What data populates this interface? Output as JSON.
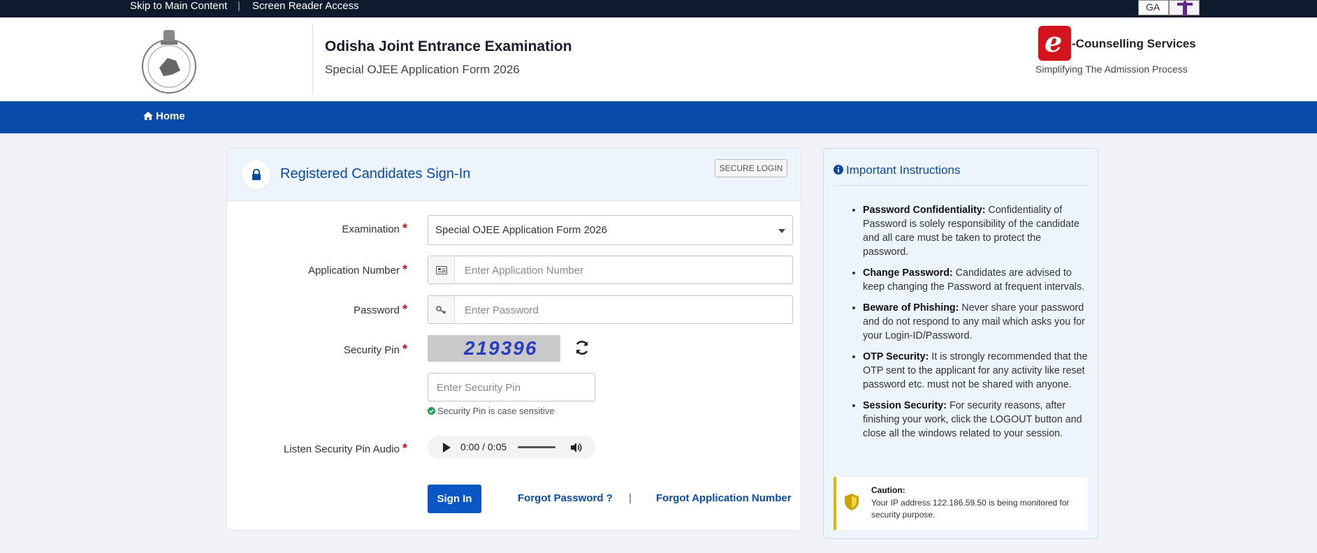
{
  "topbar": {
    "skip_link": "Skip to Main Content",
    "separator": "|",
    "screen_reader": "Screen Reader Access",
    "font_size_label": "GA",
    "accessibility_icon": "accessibility-icon"
  },
  "header": {
    "title": "Odisha Joint Entrance Examination",
    "subtitle": "Special OJEE Application Form 2026",
    "logo_letter": "e",
    "partner_name": "-Counselling Services",
    "partner_tagline": "Simplifying The Admission Process"
  },
  "nav": {
    "home": "Home"
  },
  "signin": {
    "title": "Registered Candidates Sign-In",
    "secure_badge": "SECURE LOGIN",
    "examination_label": "Examination",
    "examination_value": "Special OJEE Application Form 2026",
    "application_label": "Application Number",
    "application_placeholder": "Enter Application Number",
    "password_label": "Password",
    "password_placeholder": "Enter Password",
    "pin_label": "Security Pin",
    "captcha_text": "219396",
    "pin_placeholder": "Enter Security Pin",
    "pin_note": "Security Pin is case sensitive",
    "audio_label": "Listen Security Pin Audio",
    "audio_time": "0:00 / 0:05",
    "required_mark": "*",
    "signin_button": "Sign In",
    "forgot_password": "Forgot Password ?",
    "link_separator": "|",
    "forgot_application": "Forgot Application Number"
  },
  "instructions": {
    "title": "Important Instructions",
    "items": [
      {
        "head": "Password Confidentiality:",
        "text": " Confidentiality of Password is solely responsibility of the candidate and all care must be taken to protect the password."
      },
      {
        "head": "Change Password:",
        "text": " Candidates are advised to keep changing the Password at frequent intervals."
      },
      {
        "head": "Beware of Phishing:",
        "text": " Never share your password and do not respond to any mail which asks you for your Login-ID/Password."
      },
      {
        "head": "OTP Security:",
        "text": " It is strongly recommended that the OTP sent to the applicant for any activity like reset password etc. must not be shared with anyone."
      },
      {
        "head": "Session Security:",
        "text": " For security reasons, after finishing your work, click the LOGOUT button and close all the windows related to your session."
      }
    ],
    "caution_title": "Caution:",
    "caution_text": "Your IP address 122.186.59.50 is being monitored for security purpose."
  },
  "colors": {
    "nav": "#0a4aa8",
    "topbar": "#0e1a2e",
    "brand_red": "#d4141c",
    "required": "#c0141c"
  }
}
